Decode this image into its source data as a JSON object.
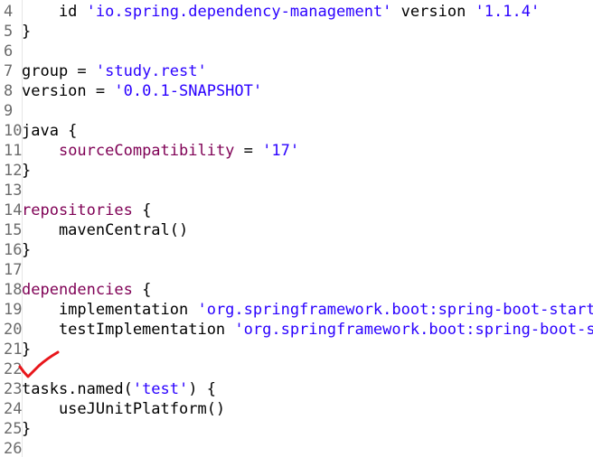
{
  "editor": {
    "lines": [
      {
        "n": "4",
        "code": [
          {
            "t": "    id ",
            "c": ""
          },
          {
            "t": "'io.spring.dependency-management'",
            "c": "str"
          },
          {
            "t": " version ",
            "c": ""
          },
          {
            "t": "'1.1.4'",
            "c": "str"
          }
        ]
      },
      {
        "n": "5",
        "code": [
          {
            "t": "}",
            "c": ""
          }
        ]
      },
      {
        "n": "6",
        "code": []
      },
      {
        "n": "7",
        "code": [
          {
            "t": "group = ",
            "c": ""
          },
          {
            "t": "'study.rest'",
            "c": "str"
          }
        ]
      },
      {
        "n": "8",
        "code": [
          {
            "t": "version = ",
            "c": ""
          },
          {
            "t": "'0.0.1-SNAPSHOT'",
            "c": "str"
          }
        ]
      },
      {
        "n": "9",
        "code": []
      },
      {
        "n": "10",
        "code": [
          {
            "t": "java {",
            "c": ""
          }
        ]
      },
      {
        "n": "11",
        "code": [
          {
            "t": "    ",
            "c": ""
          },
          {
            "t": "sourceCompatibility",
            "c": "prop"
          },
          {
            "t": " = ",
            "c": ""
          },
          {
            "t": "'17'",
            "c": "str"
          }
        ]
      },
      {
        "n": "12",
        "code": [
          {
            "t": "}",
            "c": ""
          }
        ]
      },
      {
        "n": "13",
        "code": []
      },
      {
        "n": "14",
        "code": [
          {
            "t": "repositories",
            "c": "kw"
          },
          {
            "t": " {",
            "c": ""
          }
        ]
      },
      {
        "n": "15",
        "code": [
          {
            "t": "    mavenCentral()",
            "c": ""
          }
        ]
      },
      {
        "n": "16",
        "code": [
          {
            "t": "}",
            "c": ""
          }
        ]
      },
      {
        "n": "17",
        "code": []
      },
      {
        "n": "18",
        "code": [
          {
            "t": "dependencies",
            "c": "kw"
          },
          {
            "t": " {",
            "c": ""
          }
        ]
      },
      {
        "n": "19",
        "code": [
          {
            "t": "    implementation ",
            "c": ""
          },
          {
            "t": "'org.springframework.boot:spring-boot-starte",
            "c": "str"
          }
        ]
      },
      {
        "n": "20",
        "code": [
          {
            "t": "    testImplementation ",
            "c": ""
          },
          {
            "t": "'org.springframework.boot:spring-boot-st",
            "c": "str"
          }
        ]
      },
      {
        "n": "21",
        "code": [
          {
            "t": "}",
            "c": ""
          }
        ]
      },
      {
        "n": "22",
        "code": []
      },
      {
        "n": "23",
        "code": [
          {
            "t": "tasks.named(",
            "c": ""
          },
          {
            "t": "'test'",
            "c": "str"
          },
          {
            "t": ") {",
            "c": ""
          }
        ]
      },
      {
        "n": "24",
        "code": [
          {
            "t": "    useJUnitPlatform()",
            "c": ""
          }
        ]
      },
      {
        "n": "25",
        "code": [
          {
            "t": "}",
            "c": ""
          }
        ]
      },
      {
        "n": "26",
        "code": []
      }
    ]
  },
  "colors": {
    "string": "#2a00ff",
    "keyword": "#7f0055",
    "line_number": "#6b6b6b",
    "annotation": "#e8161b"
  },
  "annotation": {
    "icon": "red-checkmark-icon"
  }
}
